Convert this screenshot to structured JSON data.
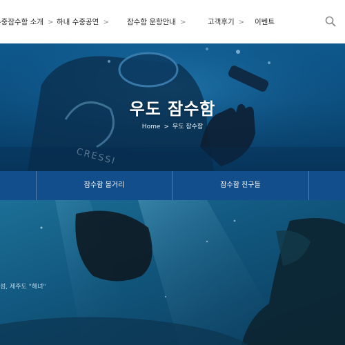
{
  "nav": {
    "items": [
      {
        "label": "수중잠수함 소개",
        "chevron": ">"
      },
      {
        "label": "하내 수중공연",
        "chevron": ">"
      },
      {
        "label": "잠수함 운항안내",
        "chevron": ">"
      },
      {
        "label": "고객후기",
        "chevron": ">"
      },
      {
        "label": "이벤트",
        "chevron": ""
      }
    ],
    "search_icon": "search-icon"
  },
  "hero": {
    "title": "우도 잠수함",
    "breadcrumb": [
      "Home",
      "우도 잠수함"
    ],
    "separator": ">",
    "suit_brand": "CRESSI"
  },
  "subtabs": {
    "items": [
      "",
      "잠수함 볼거리",
      "잠수함 친구들",
      ""
    ]
  },
  "photo": {
    "caption": "섬, 제주도 \"해녀\""
  },
  "colors": {
    "nav_bg": "#ffffff",
    "subtab_bg": "#134e8c",
    "hero_blue": "#0b4f80"
  }
}
